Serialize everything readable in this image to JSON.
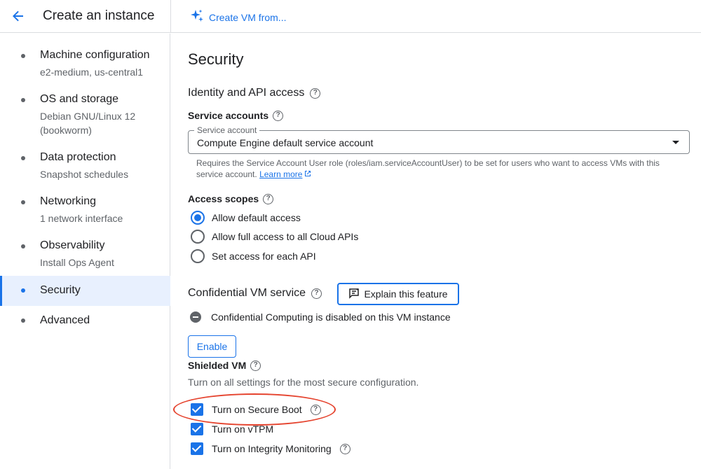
{
  "header": {
    "title": "Create an instance",
    "create_vm_label": "Create VM from..."
  },
  "sidebar": {
    "items": [
      {
        "label": "Machine configuration",
        "sub": "e2-medium, us-central1"
      },
      {
        "label": "OS and storage",
        "sub": "Debian GNU/Linux 12 (bookworm)"
      },
      {
        "label": "Data protection",
        "sub": "Snapshot schedules"
      },
      {
        "label": "Networking",
        "sub": "1 network interface"
      },
      {
        "label": "Observability",
        "sub": "Install Ops Agent"
      },
      {
        "label": "Security",
        "sub": ""
      },
      {
        "label": "Advanced",
        "sub": ""
      }
    ]
  },
  "main": {
    "title": "Security",
    "identity_heading": "Identity and API access",
    "service_accounts_label": "Service accounts",
    "service_account_floating": "Service account",
    "service_account_value": "Compute Engine default service account",
    "service_account_help": "Requires the Service Account User role (roles/iam.serviceAccountUser) to be set for users who want to access VMs with this service account.",
    "learn_more": "Learn more",
    "access_scopes_label": "Access scopes",
    "access_scopes": [
      {
        "label": "Allow default access",
        "selected": true
      },
      {
        "label": "Allow full access to all Cloud APIs",
        "selected": false
      },
      {
        "label": "Set access for each API",
        "selected": false
      }
    ],
    "confidential_heading": "Confidential VM service",
    "explain_button": "Explain this feature",
    "confidential_status": "Confidential Computing is disabled on this VM instance",
    "enable_button": "Enable",
    "shielded_label": "Shielded VM",
    "shielded_desc": "Turn on all settings for the most secure configuration.",
    "shielded_options": [
      {
        "label": "Turn on Secure Boot",
        "checked": true
      },
      {
        "label": "Turn on vTPM",
        "checked": true
      },
      {
        "label": "Turn on Integrity Monitoring",
        "checked": true
      }
    ]
  },
  "colors": {
    "accent": "#1a73e8",
    "annotation": "#e5432e",
    "active_bg": "#e8f0fe"
  }
}
